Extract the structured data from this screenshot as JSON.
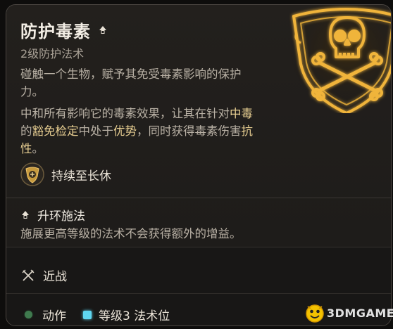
{
  "spell": {
    "name": "防护毒素",
    "subtitle": "2级防护法术",
    "desc1": "碰触一个生物，赋予其免受毒素影响的保护力。",
    "desc2_parts": {
      "a": "中和所有影响它的毒素效果，让其在针对",
      "b": "中毒",
      "c": "的",
      "d": "豁免检定",
      "e": "中处于",
      "f": "优势",
      "g": "，同时获得毒素伤害",
      "h": "抗性",
      "i": "。"
    },
    "duration": "持续至长休"
  },
  "upcast": {
    "title": "升环施法",
    "desc": "施展更高等级的法术不会获得额外的增益。"
  },
  "range": {
    "label": "近战"
  },
  "cost": {
    "action": "动作",
    "slot": "等级3 法术位"
  },
  "watermark": {
    "text": "3DMGAME"
  },
  "colors": {
    "accent": "#e8cf92",
    "seal_glow": "#f0b43a",
    "action_dot": "#3f7a4e",
    "slot_square": "#5fd6f0"
  },
  "icons": {
    "title_icon": "upcast-mini-icon",
    "seal": "poison-skull-seal-icon",
    "duration": "long-rest-duration-icon",
    "range": "melee-crossed-swords-icon",
    "watermark": "3dm-logo-icon"
  }
}
